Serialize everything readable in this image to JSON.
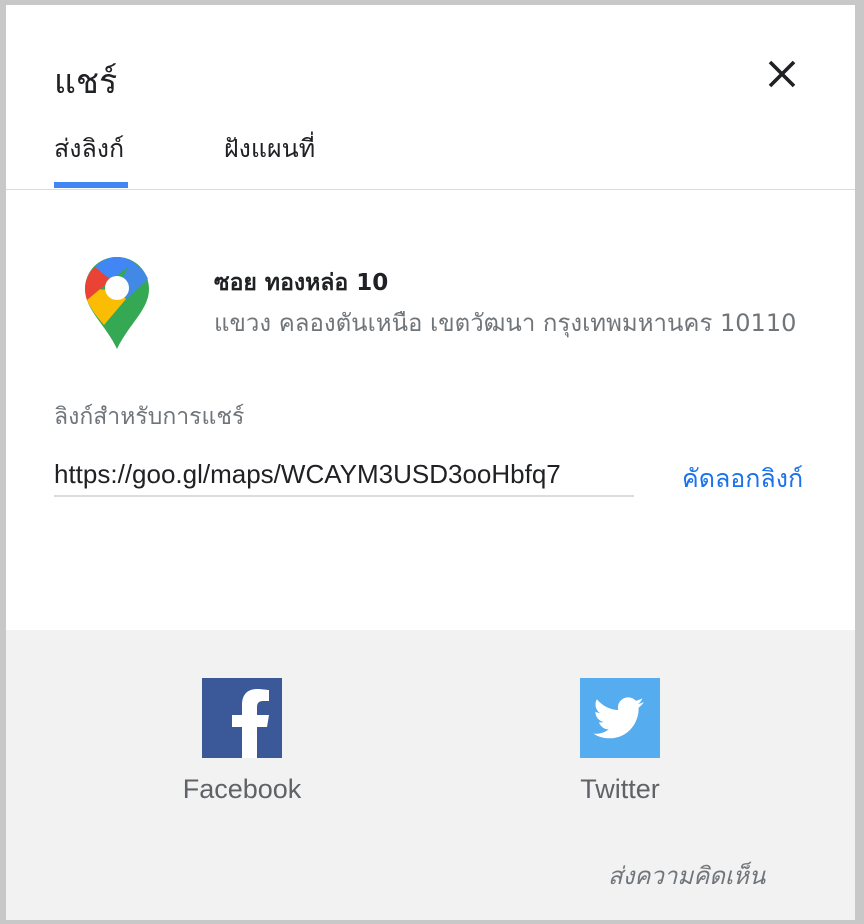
{
  "dialog": {
    "title": "แชร์",
    "close_icon": "close-icon"
  },
  "tabs": [
    {
      "label": "ส่งลิงก์",
      "active": true
    },
    {
      "label": "ฝังแผนที่",
      "active": false
    }
  ],
  "accent_color": "#4285f4",
  "place": {
    "icon": "google-maps-pin-icon",
    "name": "ซอย ทองหล่อ 10",
    "address": "แขวง คลองตันเหนือ เขตวัฒนา กรุงเทพมหานคร 10110"
  },
  "share_link": {
    "label": "ลิงก์สำหรับการแชร์",
    "url": "https://goo.gl/maps/WCAYM3USD3ooHbfq7",
    "copy_label": "คัดลอกลิงก์",
    "copy_color": "#1a73e8"
  },
  "social": [
    {
      "name": "Facebook",
      "icon": "facebook-icon",
      "color": "#3b5998"
    },
    {
      "name": "Twitter",
      "icon": "twitter-icon",
      "color": "#55acee"
    }
  ],
  "feedback_label": "ส่งความคิดเห็น"
}
